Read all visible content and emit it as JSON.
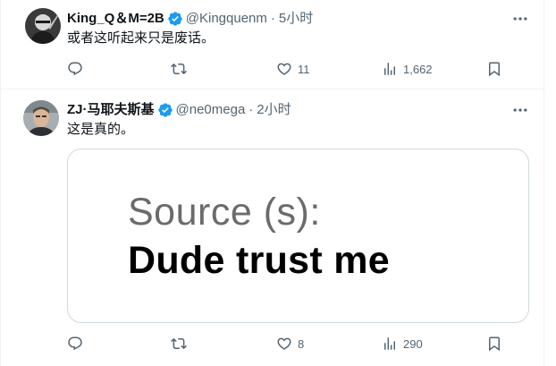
{
  "colors": {
    "verified": "#1d9bf0",
    "secondary_text": "#536471",
    "border": "#eff3f4"
  },
  "tweets": [
    {
      "author_name": "King_Q＆M=2B",
      "handle": "@Kingquenm",
      "separator": "·",
      "time": "5小时",
      "text": "或者这听起来只是废话。",
      "actions": {
        "reply": "",
        "retweet": "",
        "like": "11",
        "views": "1,662"
      }
    },
    {
      "author_name": "ZJ·马耶夫斯基",
      "handle": "@ne0mega",
      "separator": "·",
      "time": "2小时",
      "text": "这是真的。",
      "media": {
        "line1": "Source (s):",
        "line2": "Dude trust me"
      },
      "actions": {
        "reply": "",
        "retweet": "",
        "like": "8",
        "views": "290"
      }
    }
  ],
  "icons": [
    "avatar",
    "verified-badge-icon",
    "more-icon",
    "reply-icon",
    "retweet-icon",
    "like-icon",
    "views-icon",
    "bookmark-icon"
  ]
}
